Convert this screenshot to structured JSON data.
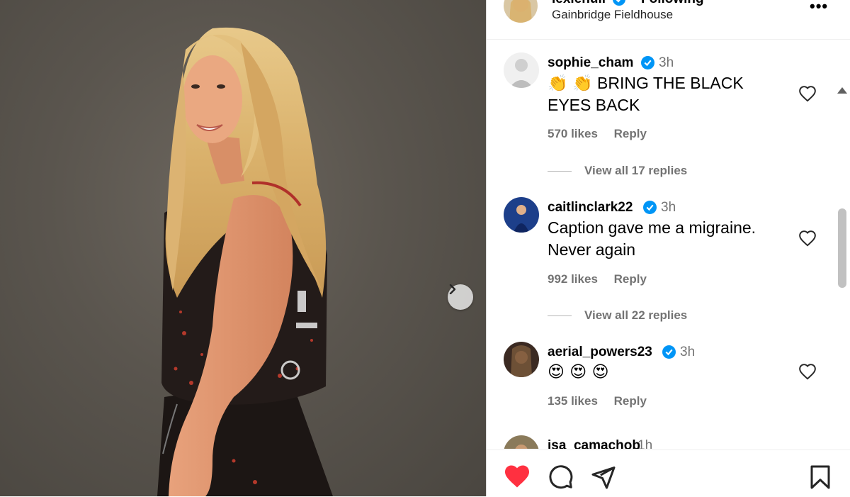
{
  "post": {
    "author": "lexiehull",
    "follow_status": "Following",
    "location": "Gainbridge Fieldhouse",
    "more_icon": "more-horizontal-icon"
  },
  "comments": [
    {
      "username": "sophie_cham",
      "verified": true,
      "time": "3h",
      "text": "👏 👏 BRING THE BLACK EYES BACK",
      "likes": "570 likes",
      "reply_label": "Reply",
      "view_replies": "View all 17 replies"
    },
    {
      "username": "caitlinclark22",
      "verified": true,
      "time": "3h",
      "text": "Caption gave me a migraine. Never again",
      "likes": "992 likes",
      "reply_label": "Reply",
      "view_replies": "View all 22 replies"
    },
    {
      "username": "aerial_powers23",
      "verified": true,
      "time": "3h",
      "text": "😍 😍 😍",
      "likes": "135 likes",
      "reply_label": "Reply"
    },
    {
      "username": "isa_camachob",
      "time": "1h"
    }
  ],
  "actions": {
    "like_icon": "heart-filled-icon",
    "comment_icon": "comment-icon",
    "share_icon": "send-icon",
    "save_icon": "bookmark-icon",
    "like_color": "#ff3040"
  },
  "colors": {
    "verified": "#0095f6",
    "secondary_text": "#737373"
  }
}
